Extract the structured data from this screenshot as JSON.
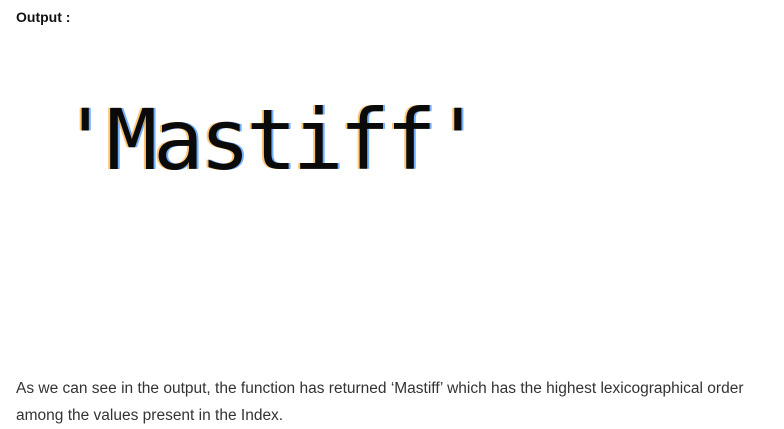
{
  "heading": "Output :",
  "output_value": "'Mastiff'",
  "paragraph": "As we can see in the output, the function has returned ‘Mastiff’ which has the highest lexicographical order among the values present in the Index."
}
